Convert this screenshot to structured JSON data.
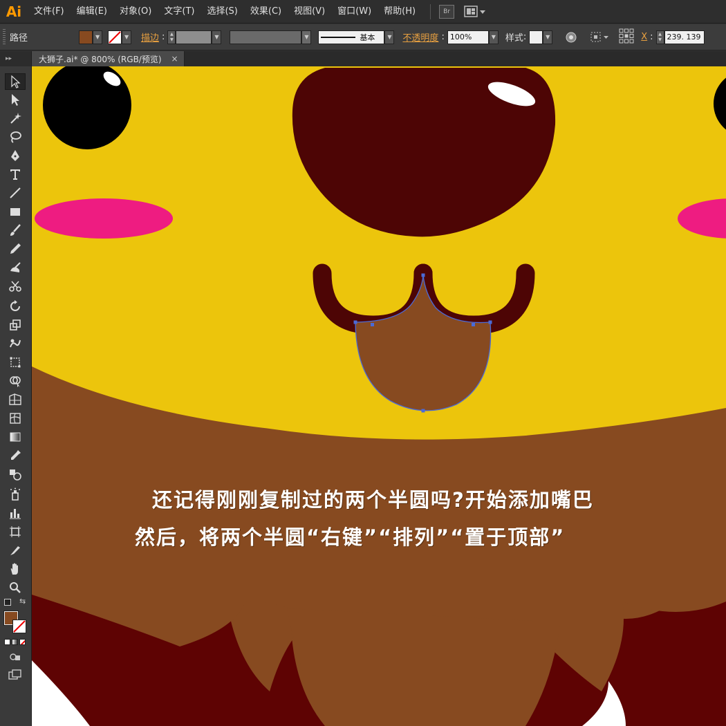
{
  "app": {
    "logo": "Ai"
  },
  "menu": [
    "文件(F)",
    "编辑(E)",
    "对象(O)",
    "文字(T)",
    "选择(S)",
    "效果(C)",
    "视图(V)",
    "窗口(W)",
    "帮助(H)"
  ],
  "menubar_buttons": {
    "bridge": "Br"
  },
  "control_bar": {
    "selection_type": "路径",
    "stroke_link": "描边",
    "stroke_profile": "基本",
    "opacity_link": "不透明度",
    "opacity_value": "100%",
    "style_label": "样式",
    "x_label": "X",
    "x_value": "239. 139"
  },
  "document": {
    "tab_title": "大狮子.ai* @ 800% (RGB/预览)",
    "close": "×"
  },
  "colors": {
    "fill": "#874a20",
    "stroke": "none"
  },
  "caption": {
    "line1": "还记得刚刚复制过的两个半圆吗?开始添加嘴巴",
    "line2": "然后，将两个半圆“右键”“排列”“置于顶部”"
  },
  "tools": [
    "selection-tool",
    "direct-selection-tool",
    "magic-wand-tool",
    "lasso-tool",
    "pen-tool",
    "type-tool",
    "line-tool",
    "rectangle-tool",
    "paintbrush-tool",
    "pencil-tool",
    "blob-brush-tool",
    "scissors-tool",
    "rotate-tool",
    "scale-tool",
    "warp-tool",
    "free-transform-tool",
    "shape-builder-tool",
    "perspective-grid-tool",
    "mesh-tool",
    "gradient-tool",
    "eyedropper-tool",
    "blend-tool",
    "symbol-sprayer-tool",
    "column-graph-tool",
    "artboard-tool",
    "slice-tool",
    "hand-tool",
    "zoom-tool"
  ]
}
